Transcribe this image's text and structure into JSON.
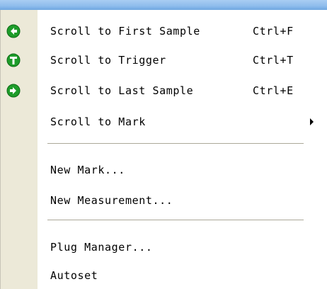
{
  "menu": {
    "items": [
      {
        "label": "Scroll to First Sample",
        "shortcut": "Ctrl+F",
        "icon": "arrow-left-circle-icon"
      },
      {
        "label": "Scroll to Trigger",
        "shortcut": "Ctrl+T",
        "icon": "trigger-t-circle-icon"
      },
      {
        "label": "Scroll to Last Sample",
        "shortcut": "Ctrl+E",
        "icon": "arrow-right-circle-icon"
      },
      {
        "label": "Scroll to Mark",
        "has_submenu": true
      },
      {
        "label": "New Mark..."
      },
      {
        "label": "New Measurement..."
      },
      {
        "label": "Plug Manager..."
      },
      {
        "label": "Autoset"
      }
    ]
  },
  "colors": {
    "icon_green": "#1e9c2a",
    "icon_border": "#0d6b16",
    "strip": "#ece9d8",
    "separator": "#aca899"
  }
}
